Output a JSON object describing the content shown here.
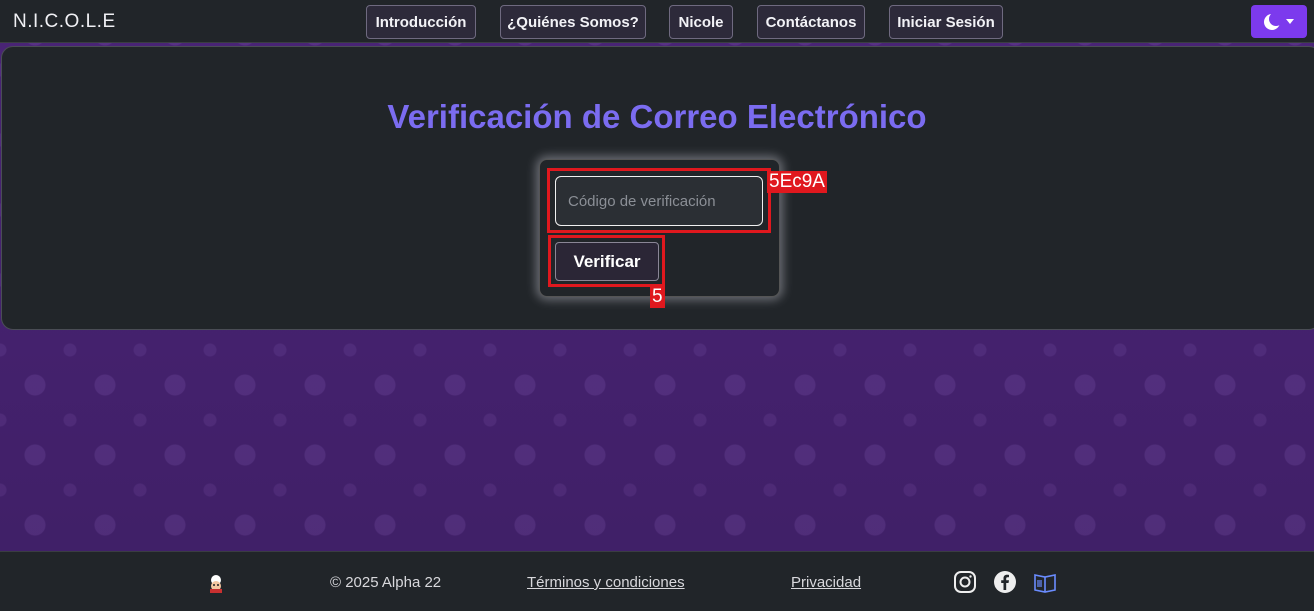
{
  "navbar": {
    "brand": "N.I.C.O.L.E",
    "links": [
      "Introducción",
      "¿Quiénes Somos?",
      "Nicole",
      "Contáctanos",
      "Iniciar Sesión"
    ],
    "theme_icon": "moon-icon"
  },
  "main": {
    "title": "Verificación de Correo Electrónico",
    "code_input": {
      "placeholder": "Código de verificación",
      "value": ""
    },
    "verify_label": "Verificar"
  },
  "annotations": {
    "input_label": "5Ec9A",
    "button_label": "5"
  },
  "footer": {
    "copyright": "© 2025 Alpha 22",
    "terms": "Términos y condiciones",
    "privacy": "Privacidad",
    "social_icons": [
      "instagram-icon",
      "facebook-icon",
      "book-icon"
    ]
  },
  "colors": {
    "accent": "#7b6cf0",
    "theme_button": "#7c3aed",
    "annotation": "#e0181e",
    "background": "#4a2476"
  }
}
